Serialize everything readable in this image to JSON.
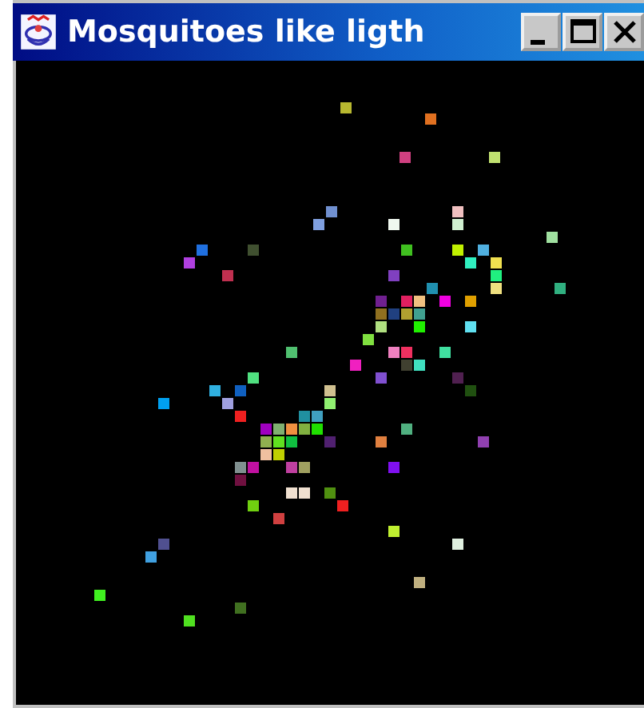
{
  "window": {
    "title": "Mosquitoes like ligth"
  }
}
